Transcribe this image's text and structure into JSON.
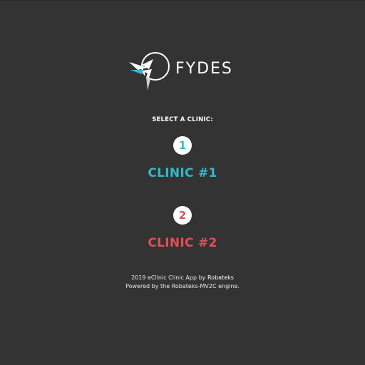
{
  "brand": {
    "name": "FYDES"
  },
  "prompt": {
    "label": "SELECT A CLINIC:"
  },
  "clinics": [
    {
      "number": "1",
      "title": "CLINIC #1",
      "color": "#34b8c9"
    },
    {
      "number": "2",
      "title": "CLINIC #2",
      "color": "#e0505a"
    }
  ],
  "footer": {
    "line1_prefix": "2019 eClinic Clinic App by",
    "line1_link": "Robateks",
    "line2": "Powered by the Robateks-MV2C engine."
  }
}
